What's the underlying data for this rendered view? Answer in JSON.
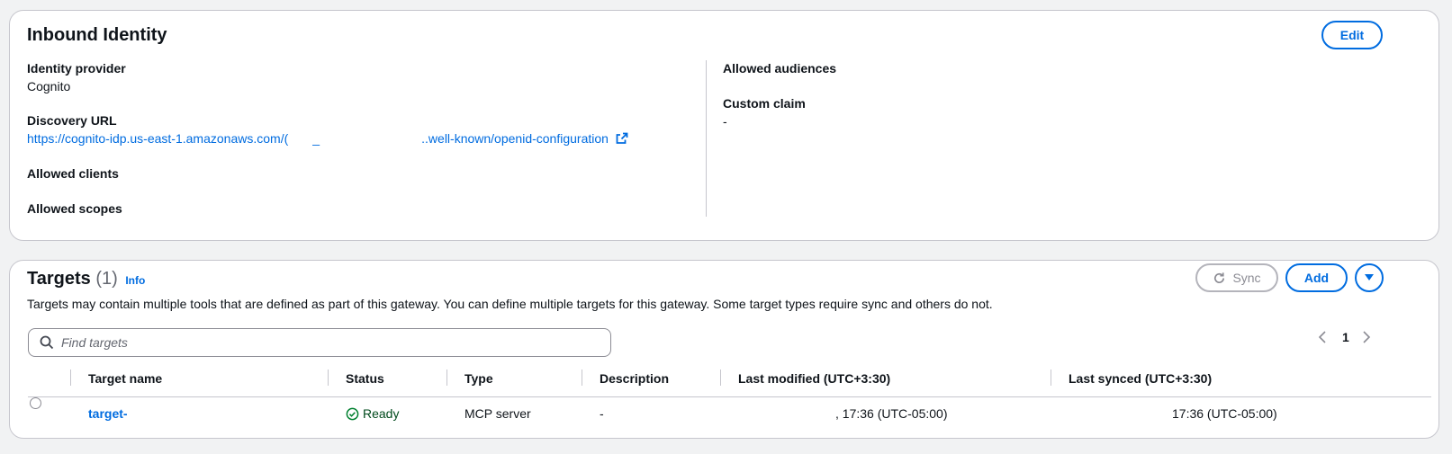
{
  "identity": {
    "title": "Inbound Identity",
    "edit_label": "Edit",
    "provider_label": "Identity provider",
    "provider_value": "Cognito",
    "discovery_label": "Discovery URL",
    "discovery_prefix": "https://cognito-idp.us-east-1.amazonaws.com/(",
    "discovery_suffix": ".well-known/openid-configuration",
    "allowed_clients_label": "Allowed clients",
    "allowed_scopes_label": "Allowed scopes",
    "allowed_audiences_label": "Allowed audiences",
    "custom_claim_label": "Custom claim",
    "custom_claim_value": "-"
  },
  "targets": {
    "title": "Targets",
    "count": "(1)",
    "info_label": "Info",
    "sync_label": "Sync",
    "add_label": "Add",
    "description": "Targets may contain multiple tools that are defined as part of this gateway. You can define multiple targets for this gateway. Some target types require sync and others do not.",
    "search_placeholder": "Find targets",
    "page_number": "1",
    "columns": {
      "name": "Target name",
      "status": "Status",
      "type": "Type",
      "description": "Description",
      "last_modified": "Last modified (UTC+3:30)",
      "last_synced": "Last synced (UTC+3:30)"
    },
    "rows": [
      {
        "name": "target-",
        "status": "Ready",
        "type": "MCP server",
        "description": "-",
        "last_modified": ", 17:36 (UTC-05:00)",
        "last_synced": "17:36 (UTC-05:00)"
      }
    ]
  },
  "colors": {
    "link": "#006ce0",
    "success": "#00802f",
    "border": "#c6c6cd"
  },
  "icons": [
    "external-link-icon",
    "info-link",
    "refresh-icon",
    "caret-down-icon",
    "search-icon",
    "chevron-left-icon",
    "chevron-right-icon",
    "status-success-icon"
  ]
}
